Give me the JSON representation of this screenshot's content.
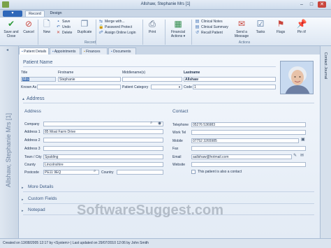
{
  "window": {
    "title": "Allshaw, Stephanie Mrs [1]",
    "minimize": "–",
    "maximize": "□",
    "close": "✕"
  },
  "ribbon": {
    "app_button": "▾",
    "tabs": [
      "Record",
      "Design"
    ],
    "save_close": [
      "Save and",
      "Close"
    ],
    "cancel": "Cancel",
    "new": "New",
    "save": "Save",
    "undo": "Undo",
    "delete": "Delete",
    "duplicate": "Duplicate",
    "group_record": "Record",
    "merge": "Merge with...",
    "password_protect": "Password Protect",
    "assign_login": "Assign Online Login",
    "print": "Print",
    "financial_actions": [
      "Financial",
      "Actions ▾"
    ],
    "clinical_notes": "Clinical Notes",
    "clinical_summary": "Clinical Summary",
    "recall_patient": "Recall Patient",
    "send_message": [
      "Send a",
      "Message"
    ],
    "tasks": "Tasks",
    "flags": "Flags",
    "pin_it": "Pin it!",
    "group_actions": "Actions"
  },
  "sidebar": {
    "name": "Allshaw, Stephanie Mrs [1]"
  },
  "journal": {
    "label": "Contact Journal"
  },
  "page_tabs": [
    "Patient Details",
    "Appointments",
    "Finances",
    "Documents"
  ],
  "patient_name": {
    "section": "Patient Name",
    "title_label": "Title",
    "title_value": "Mrs",
    "firstname_label": "Firstname",
    "firstname_value": "Stephanie",
    "middlename_label": "Middlename(s)",
    "middlename_value": "",
    "lastname_label": "Lastname",
    "lastname_value": "Allshaw",
    "knownas_label": "Known As",
    "knownas_value": "",
    "category_label": "Patient Category",
    "category_value": "",
    "code_label": "Code",
    "code_value": "1"
  },
  "address_section": "Address",
  "address": {
    "header": "Address",
    "rows": [
      {
        "label": "Company",
        "value": ""
      },
      {
        "label": "Address 1",
        "value": "85 Moat Farm Drive"
      },
      {
        "label": "Address 2",
        "value": ""
      },
      {
        "label": "Address 3",
        "value": ""
      },
      {
        "label": "Town / City",
        "value": "Spalding"
      },
      {
        "label": "County",
        "value": "Lincolnshire"
      }
    ],
    "postcode_label": "Postcode",
    "postcode_value": "PE11 9EQ",
    "country_label": "Country",
    "country_value": ""
  },
  "contact": {
    "header": "Contact",
    "rows": [
      {
        "label": "Telephone",
        "value": "05276 536983"
      },
      {
        "label": "Work Tel",
        "value": ""
      },
      {
        "label": "Mobile",
        "value": "07752 3265985"
      },
      {
        "label": "Fax",
        "value": ""
      },
      {
        "label": "Email",
        "value": "aallshaw@hotmail.com"
      },
      {
        "label": "Website",
        "value": ""
      }
    ],
    "also_contact": "This patient is also a contact"
  },
  "collapsed": [
    "More Details",
    "Custom Fields",
    "Notepad"
  ],
  "status": "Created on 13/08/2005 12:17 by <System> | Last updated on 29/07/2010 12:06 by John Smith",
  "watermark": "SoftwareSuggest.com",
  "colors": {
    "accent": "#2f68b9",
    "ribbon": "#dce6f2",
    "content": "#e8eff7"
  }
}
